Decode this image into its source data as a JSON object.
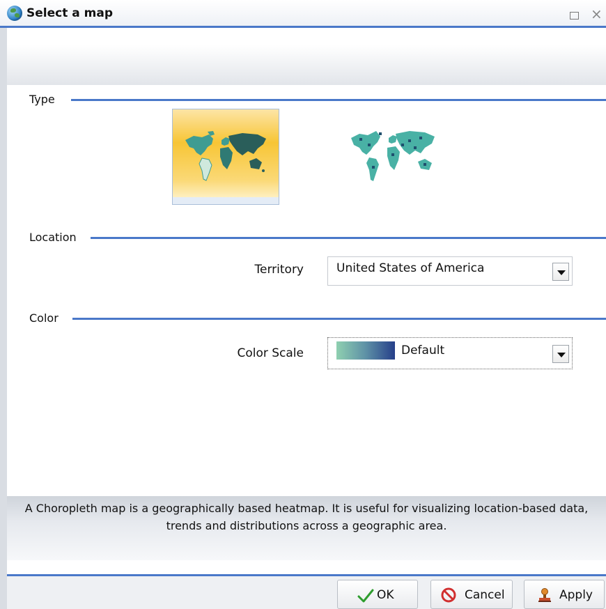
{
  "window": {
    "title": "Select a map",
    "icon": "globe-icon",
    "controls": [
      "maximize-icon",
      "close-icon"
    ]
  },
  "sections": {
    "type": {
      "label": "Type",
      "options": [
        "choropleth-map",
        "bubble-map"
      ],
      "selected": "choropleth-map"
    },
    "location": {
      "label": "Location",
      "territory_label": "Territory",
      "territory_value": "United States of America"
    },
    "color": {
      "label": "Color",
      "scale_label": "Color Scale",
      "scale_value": "Default"
    }
  },
  "description": {
    "line1": "A Choropleth map is a geographically based heatmap. It is useful for visualizing location-based data,",
    "line2": "trends and distributions across a geographic area."
  },
  "buttons": {
    "ok": "OK",
    "cancel": "Cancel",
    "apply": "Apply"
  },
  "colors": {
    "accent": "#4a78c9",
    "selected_thumb": "#f7c535",
    "map_teal": "#3f9c92",
    "map_dark": "#2a5e5a"
  }
}
